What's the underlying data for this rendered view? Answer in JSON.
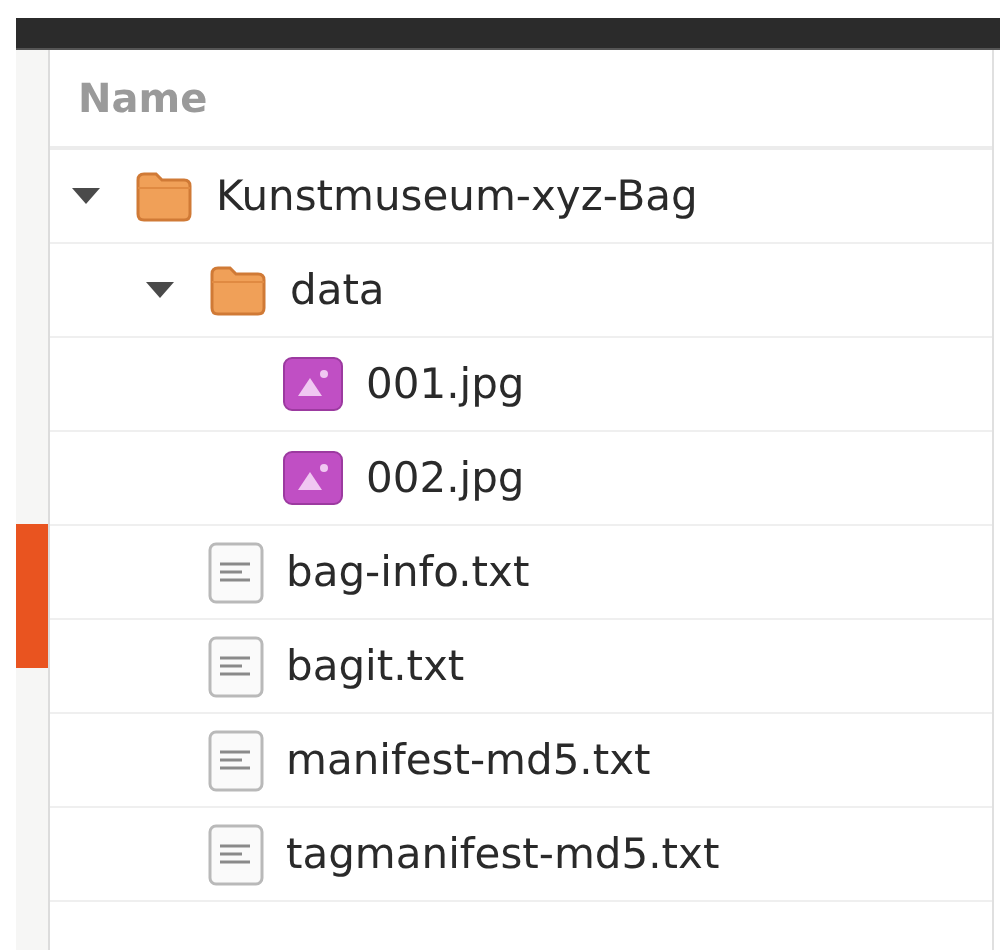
{
  "column_header": "Name",
  "tree": [
    {
      "name": "Kunstmuseum-xyz-Bag",
      "kind": "folder",
      "expanded": true,
      "children": [
        {
          "name": "data",
          "kind": "folder",
          "expanded": true,
          "children": [
            {
              "name": "001.jpg",
              "kind": "image"
            },
            {
              "name": "002.jpg",
              "kind": "image"
            }
          ]
        },
        {
          "name": "bag-info.txt",
          "kind": "text"
        },
        {
          "name": "bagit.txt",
          "kind": "text"
        },
        {
          "name": "manifest-md5.txt",
          "kind": "text"
        },
        {
          "name": "tagmanifest-md5.txt",
          "kind": "text"
        }
      ]
    }
  ]
}
